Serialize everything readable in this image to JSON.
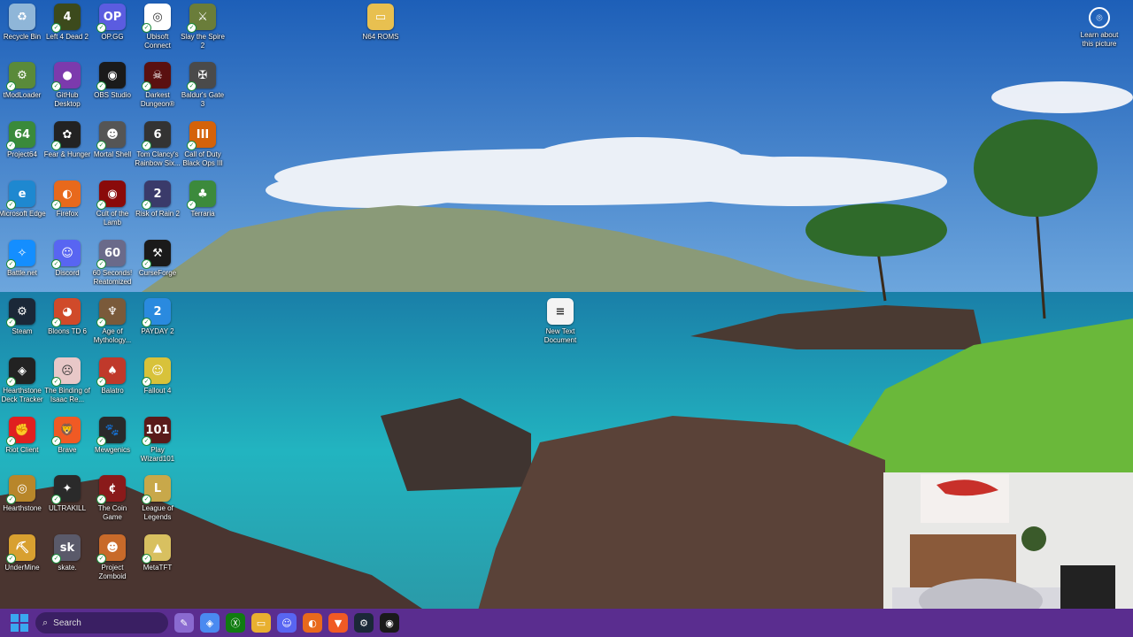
{
  "desktop": {
    "icons": [
      {
        "label": "Recycle Bin",
        "icon": "recycle-bin-icon",
        "color": "#8fb6d8",
        "glyph": "♻"
      },
      {
        "label": "Left 4 Dead 2",
        "icon": "left4dead2-icon",
        "color": "#3c4a1c",
        "glyph": "4"
      },
      {
        "label": "OP.GG",
        "icon": "opgg-icon",
        "color": "#5b5ce0",
        "glyph": "OP"
      },
      {
        "label": "Ubisoft Connect",
        "icon": "ubisoft-icon",
        "color": "#ffffff",
        "glyph": "◎"
      },
      {
        "label": "Slay the Spire 2",
        "icon": "slay-the-spire-icon",
        "color": "#6a7d3a",
        "glyph": "⚔"
      },
      {
        "label": "tModLoader",
        "icon": "tmodloader-icon",
        "color": "#5a8a3a",
        "glyph": "⚙"
      },
      {
        "label": "GitHub Desktop",
        "icon": "github-icon",
        "color": "#7c3aad",
        "glyph": "●"
      },
      {
        "label": "OBS Studio",
        "icon": "obs-icon",
        "color": "#1a1a1a",
        "glyph": "◉"
      },
      {
        "label": "Darkest Dungeon®",
        "icon": "darkest-dungeon-icon",
        "color": "#5a1010",
        "glyph": "☠"
      },
      {
        "label": "Baldur's Gate 3",
        "icon": "baldurs-gate-icon",
        "color": "#4a4a4a",
        "glyph": "✠"
      },
      {
        "label": "Project64",
        "icon": "project64-icon",
        "color": "#3a8a3a",
        "glyph": "64"
      },
      {
        "label": "Fear & Hunger",
        "icon": "fear-hunger-icon",
        "color": "#222222",
        "glyph": "✿"
      },
      {
        "label": "Mortal Shell",
        "icon": "mortal-shell-icon",
        "color": "#555555",
        "glyph": "☻"
      },
      {
        "label": "Tom Clancy's Rainbow Six...",
        "icon": "rainbow-six-icon",
        "color": "#333333",
        "glyph": "6"
      },
      {
        "label": "Call of Duty Black Ops III",
        "icon": "cod-bo3-icon",
        "color": "#d4620a",
        "glyph": "III"
      },
      {
        "label": "Microsoft Edge",
        "icon": "edge-icon",
        "color": "#1e88d0",
        "glyph": "e"
      },
      {
        "label": "Firefox",
        "icon": "firefox-icon",
        "color": "#e8691c",
        "glyph": "◐"
      },
      {
        "label": "Cult of the Lamb",
        "icon": "cult-of-the-lamb-icon",
        "color": "#8a0a0a",
        "glyph": "◉"
      },
      {
        "label": "Risk of Rain 2",
        "icon": "risk-of-rain-icon",
        "color": "#3a3a6a",
        "glyph": "2"
      },
      {
        "label": "Terraria",
        "icon": "terraria-icon",
        "color": "#3c8a3c",
        "glyph": "♣"
      },
      {
        "label": "Battle.net",
        "icon": "battlenet-icon",
        "color": "#148eff",
        "glyph": "✧"
      },
      {
        "label": "Discord",
        "icon": "discord-icon",
        "color": "#5865f2",
        "glyph": "☺"
      },
      {
        "label": "60 Seconds! Reatomized",
        "icon": "60-seconds-icon",
        "color": "#6a6a8a",
        "glyph": "60"
      },
      {
        "label": "CurseForge",
        "icon": "curseforge-icon",
        "color": "#1a1a1a",
        "glyph": "⚒"
      },
      {
        "label": "Steam",
        "icon": "steam-icon",
        "color": "#1b2838",
        "glyph": "⚙"
      },
      {
        "label": "Bloons TD 6",
        "icon": "bloons-icon",
        "color": "#d04a2a",
        "glyph": "◕"
      },
      {
        "label": "Age of Mythology...",
        "icon": "age-of-mythology-icon",
        "color": "#7a5a3a",
        "glyph": "♆"
      },
      {
        "label": "PAYDAY 2",
        "icon": "payday2-icon",
        "color": "#2a8adf",
        "glyph": "2"
      },
      {
        "label": "Hearthstone Deck Tracker",
        "icon": "hdt-icon",
        "color": "#222222",
        "glyph": "◈"
      },
      {
        "label": "The Binding of Isaac Re...",
        "icon": "isaac-icon",
        "color": "#e8c8c8",
        "glyph": "☹"
      },
      {
        "label": "Balatro",
        "icon": "balatro-icon",
        "color": "#c0392b",
        "glyph": "♠"
      },
      {
        "label": "Fallout 4",
        "icon": "fallout4-icon",
        "color": "#d8c23a",
        "glyph": "☺"
      },
      {
        "label": "Riot Client",
        "icon": "riot-icon",
        "color": "#e02020",
        "glyph": "✊"
      },
      {
        "label": "Brave",
        "icon": "brave-icon",
        "color": "#f05a24",
        "glyph": "🦁"
      },
      {
        "label": "Mewgenics",
        "icon": "mewgenics-icon",
        "color": "#2a2a2a",
        "glyph": "🐾"
      },
      {
        "label": "Play Wizard101",
        "icon": "wizard101-icon",
        "color": "#5a1a1a",
        "glyph": "101"
      },
      {
        "label": "Hearthstone",
        "icon": "hearthstone-icon",
        "color": "#b8862a",
        "glyph": "◎"
      },
      {
        "label": "ULTRAKILL",
        "icon": "ultrakill-icon",
        "color": "#2a2a2a",
        "glyph": "✦"
      },
      {
        "label": "The Coin Game",
        "icon": "coin-game-icon",
        "color": "#8a1a1a",
        "glyph": "¢"
      },
      {
        "label": "League of Legends",
        "icon": "lol-icon",
        "color": "#c8a84a",
        "glyph": "L"
      },
      {
        "label": "UnderMine",
        "icon": "undermine-icon",
        "color": "#d8a030",
        "glyph": "⛏"
      },
      {
        "label": "skate.",
        "icon": "skate-icon",
        "color": "#5a5a6a",
        "glyph": "sk"
      },
      {
        "label": "Project Zomboid",
        "icon": "zomboid-icon",
        "color": "#c86a2a",
        "glyph": "☻"
      },
      {
        "label": "MetaTFT",
        "icon": "metatft-icon",
        "color": "#d8c060",
        "glyph": "▲"
      },
      {
        "label": "N64 ROMS",
        "icon": "folder-icon",
        "color": "#e8c050",
        "glyph": "▭"
      },
      {
        "label": "New Text Document",
        "icon": "text-document-icon",
        "color": "#f4f4f4",
        "glyph": "≡"
      }
    ]
  },
  "spotlight": {
    "label": "Learn about this picture",
    "icon": "camera-icon"
  },
  "taskbar": {
    "search_placeholder": "Search",
    "apps": [
      {
        "name": "pen-app-icon",
        "color": "#8a6ad0",
        "glyph": "✎"
      },
      {
        "name": "copilot-icon",
        "color": "#4a8af0",
        "glyph": "◈"
      },
      {
        "name": "xbox-icon",
        "color": "#107c10",
        "glyph": "Ⓧ"
      },
      {
        "name": "file-explorer-icon",
        "color": "#e8b030",
        "glyph": "▭"
      },
      {
        "name": "discord-icon",
        "color": "#5865f2",
        "glyph": "☺"
      },
      {
        "name": "firefox-icon",
        "color": "#e8691c",
        "glyph": "◐"
      },
      {
        "name": "brave-icon",
        "color": "#f05a24",
        "glyph": "▼"
      },
      {
        "name": "steam-icon",
        "color": "#1b2838",
        "glyph": "⚙"
      },
      {
        "name": "obs-icon",
        "color": "#1a1a1a",
        "glyph": "◉"
      }
    ]
  },
  "colors": {
    "taskbar": "#5a2d8f",
    "sky": "#2f6fc0",
    "sea": "#1fa4b8"
  }
}
